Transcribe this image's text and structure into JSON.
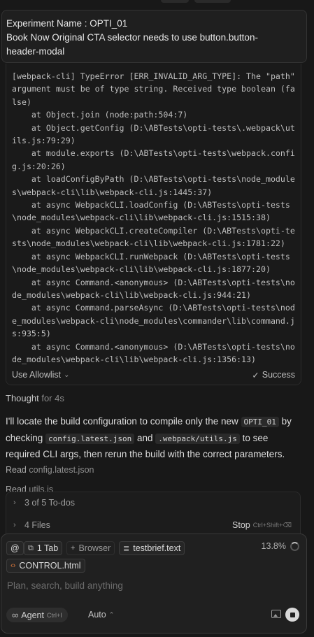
{
  "pinned_message": {
    "line1": "Experiment Name : OPTI_01",
    "line2": "Book Now Original CTA selector needs to use button.button-",
    "line3": "header-modal"
  },
  "terminal": {
    "output": "[webpack-cli] TypeError [ERR_INVALID_ARG_TYPE]: The \"path\" argument must be of type string. Received type boolean (false)\n    at Object.join (node:path:504:7)\n    at Object.getConfig (D:\\ABTests\\opti-tests\\.webpack\\utils.js:79:29)\n    at module.exports (D:\\ABTests\\opti-tests\\webpack.config.js:20:26)\n    at loadConfigByPath (D:\\ABTests\\opti-tests\\node_modules\\webpack-cli\\lib\\webpack-cli.js:1445:37)\n    at async WebpackCLI.loadConfig (D:\\ABTests\\opti-tests\\node_modules\\webpack-cli\\lib\\webpack-cli.js:1515:38)\n    at async WebpackCLI.createCompiler (D:\\ABTests\\opti-tests\\node_modules\\webpack-cli\\lib\\webpack-cli.js:1781:22)\n    at async WebpackCLI.runWebpack (D:\\ABTests\\opti-tests\\node_modules\\webpack-cli\\lib\\webpack-cli.js:1877:20)\n    at async Command.<anonymous> (D:\\ABTests\\opti-tests\\node_modules\\webpack-cli\\lib\\webpack-cli.js:944:21)\n    at async Command.parseAsync (D:\\ABTests\\opti-tests\\node_modules\\webpack-cli\\node_modules\\commander\\lib\\command.js:935:5)\n    at async Command.<anonymous> (D:\\ABTests\\opti-tests\\node_modules\\webpack-cli\\lib\\webpack-cli.js:1356:13)",
    "allowlist_label": "Use Allowlist",
    "status_label": "Success"
  },
  "thought": {
    "label": "Thought",
    "duration": "for 4s"
  },
  "assistant_text": {
    "p1": "I'll locate the build configuration to compile only the new ",
    "code1": "OPTI_01",
    "p2": " by checking ",
    "code2": "config.latest.json",
    "p3": " and ",
    "code3": ".webpack/utils.js",
    "p4": " to see required CLI args, then rerun the build with the correct parameters."
  },
  "reads": [
    {
      "verb": "Read",
      "file": "config.latest.json"
    },
    {
      "verb": "Read",
      "file": "utils.js"
    }
  ],
  "todo_panel": {
    "todos_label": "3 of 5 To-dos",
    "files_label": "4 Files",
    "stop_label": "Stop",
    "stop_shortcut": "Ctrl+Shift+⌫"
  },
  "composer": {
    "context_chips": [
      {
        "icon": "@",
        "label": ""
      },
      {
        "icon": "tabs-icon",
        "label": "1 Tab"
      },
      {
        "icon": "+",
        "label": "Browser"
      },
      {
        "icon": "file-icon",
        "label": "testbrief.text"
      }
    ],
    "file_chip": "CONTROL.html",
    "context_percent": "13.8%",
    "placeholder": "Plan, search, build anything",
    "mode_label": "Agent",
    "mode_shortcut": "Ctrl+I",
    "model_label": "Auto"
  }
}
